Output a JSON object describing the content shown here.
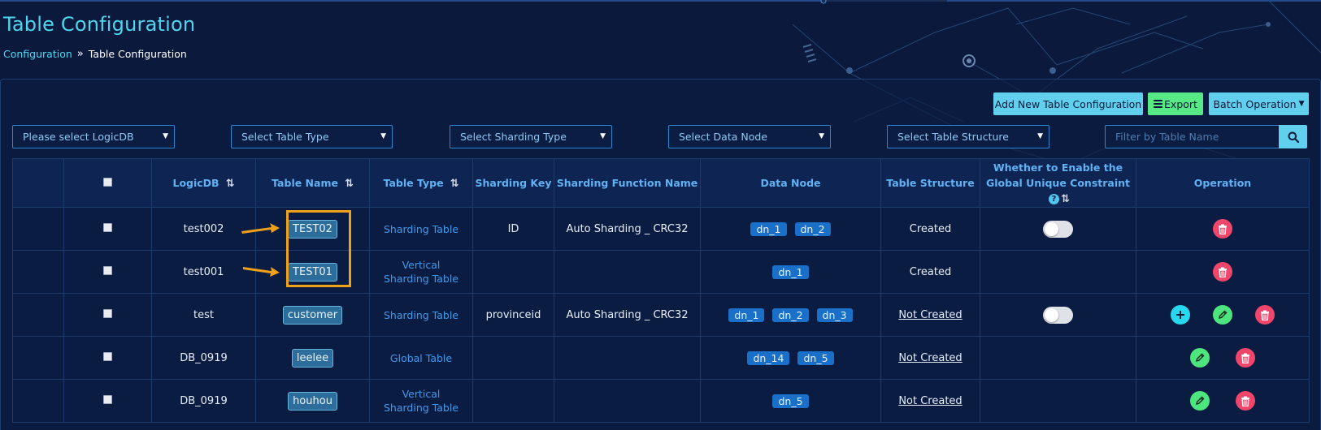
{
  "page": {
    "title": "Table Configuration",
    "breadcrumb": {
      "link": "Configuration",
      "separator": "»",
      "current": "Table Configuration"
    }
  },
  "toolbar": {
    "add_label": "Add New Table Configuration",
    "export_label": "Export",
    "batch_label": "Batch Operation"
  },
  "filters": {
    "logicdb": "Please select LogicDB",
    "table_type": "Select Table Type",
    "sharding_type": "Select Sharding Type",
    "data_node": "Select Data Node",
    "table_structure": "Select Table Structure",
    "search_placeholder": "Filter by Table Name"
  },
  "table": {
    "headers": {
      "logicdb": "LogicDB",
      "table_name": "Table Name",
      "table_type": "Table Type",
      "sharding_key": "Sharding Key",
      "sharding_function": "Sharding Function Name",
      "data_node": "Data Node",
      "table_structure": "Table Structure",
      "global_unique_1": "Whether to Enable the",
      "global_unique_2": "Global Unique Constraint",
      "help": "?",
      "operation": "Operation"
    },
    "rows": [
      {
        "logicdb": "test002",
        "table_name": "TEST02",
        "table_type_1": "Sharding Table",
        "table_type_2": "",
        "sharding_key": "ID",
        "sharding_function": "Auto Sharding _ CRC32",
        "data_nodes": [
          "dn_1",
          "dn_2"
        ],
        "structure": "Created",
        "structure_link": false,
        "toggle": true,
        "ops": [
          "delete"
        ]
      },
      {
        "logicdb": "test001",
        "table_name": "TEST01",
        "table_type_1": "Vertical",
        "table_type_2": "Sharding Table",
        "sharding_key": "",
        "sharding_function": "",
        "data_nodes": [
          "dn_1"
        ],
        "structure": "Created",
        "structure_link": false,
        "toggle": false,
        "ops": [
          "delete"
        ]
      },
      {
        "logicdb": "test",
        "table_name": "customer",
        "table_type_1": "Sharding Table",
        "table_type_2": "",
        "sharding_key": "provinceid",
        "sharding_function": "Auto Sharding _ CRC32",
        "data_nodes": [
          "dn_1",
          "dn_2",
          "dn_3"
        ],
        "structure": "Not Created",
        "structure_link": true,
        "toggle": true,
        "ops": [
          "add",
          "edit",
          "delete"
        ]
      },
      {
        "logicdb": "DB_0919",
        "table_name": "leelee",
        "table_type_1": "Global Table",
        "table_type_2": "",
        "sharding_key": "",
        "sharding_function": "",
        "data_nodes": [
          "dn_14",
          "dn_5"
        ],
        "structure": "Not Created",
        "structure_link": true,
        "toggle": false,
        "ops": [
          "edit",
          "delete"
        ]
      },
      {
        "logicdb": "DB_0919",
        "table_name": "houhou",
        "table_type_1": "Vertical",
        "table_type_2": "Sharding Table",
        "sharding_key": "",
        "sharding_function": "",
        "data_nodes": [
          "dn_5"
        ],
        "structure": "Not Created",
        "structure_link": true,
        "toggle": false,
        "ops": [
          "edit",
          "delete"
        ]
      }
    ]
  },
  "colors": {
    "background": "#0b1a3c",
    "accent": "#61d0ee",
    "export": "#58e987",
    "delete": "#f1466c",
    "edit": "#4ce57e",
    "add": "#27d8ef",
    "annotation": "#f0a11a"
  },
  "icons": [
    "search-icon",
    "menu-icon",
    "sort-icon",
    "help-icon",
    "plus-icon",
    "pencil-icon",
    "trash-icon",
    "arrow-annotation-icon"
  ]
}
